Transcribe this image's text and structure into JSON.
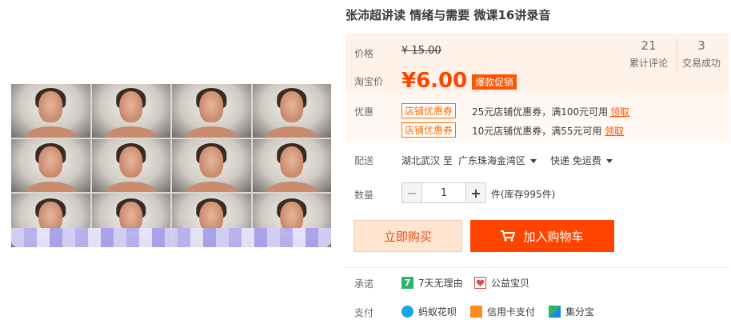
{
  "product": {
    "title": "张沛超讲读 情绪与需要 微课16讲录音"
  },
  "price": {
    "label": "价格",
    "currency": "¥",
    "original": "15.00",
    "promo_label": "淘宝价",
    "promo_currency": "¥",
    "promo_value": "6.00",
    "badge": "爆款促销"
  },
  "stats": [
    {
      "value": "21",
      "label": "累计评论"
    },
    {
      "value": "3",
      "label": "交易成功"
    }
  ],
  "promotions": {
    "label": "优惠",
    "coupons": [
      {
        "tag": "店铺优惠券",
        "desc": "25元店铺优惠券，满100元可用",
        "action": "领取"
      },
      {
        "tag": "店铺优惠券",
        "desc": "10元店铺优惠券，满55元可用",
        "action": "领取"
      }
    ]
  },
  "delivery": {
    "label": "配送",
    "from": "湖北武汉 至",
    "to": "广东珠海金湾区",
    "method": "快递 免运费"
  },
  "quantity": {
    "label": "数量",
    "value": "1",
    "minus": "−",
    "plus": "+",
    "stock": "件(库存995件)"
  },
  "actions": {
    "buy_now": "立即购买",
    "add_to_cart": "加入购物车"
  },
  "promises": {
    "label": "承诺",
    "items": [
      {
        "icon": "7",
        "text": "7天无理由"
      },
      {
        "icon": "charity",
        "text": "公益宝贝"
      }
    ]
  },
  "payment": {
    "label": "支付",
    "items": [
      {
        "text": "蚂蚁花呗"
      },
      {
        "text": "信用卡支付"
      },
      {
        "text": "集分宝"
      }
    ]
  },
  "colors": {
    "accent": "#ff4400",
    "price_bg": "#fff2e8",
    "coupon": "#ff6a00"
  }
}
